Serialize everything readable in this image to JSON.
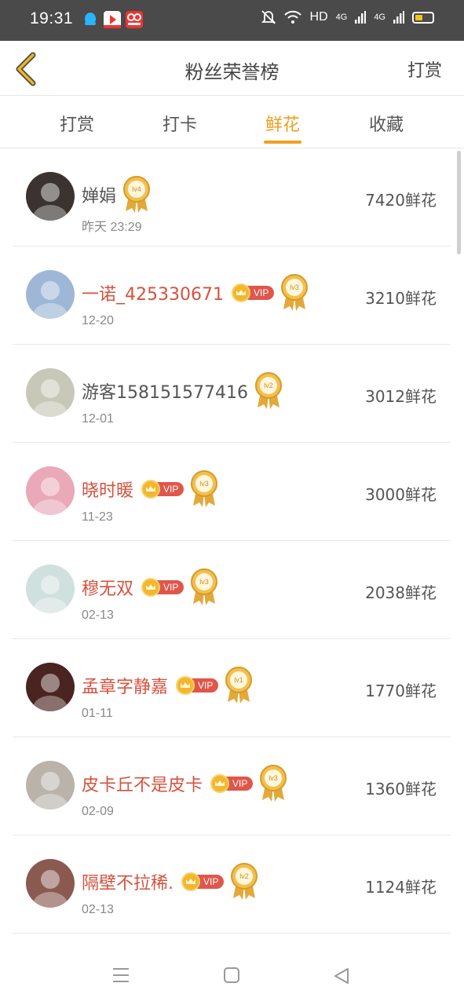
{
  "status_bar": {
    "time": "19:31",
    "network": "HD",
    "signal1": "4G",
    "signal2": "4G",
    "battery_color": "#f5c518"
  },
  "header": {
    "title": "粉丝荣誉榜",
    "right_action": "打赏",
    "back_icon": "chevron-left-icon",
    "accent": "#f0a020"
  },
  "tabs": [
    {
      "label": "打赏",
      "active": false
    },
    {
      "label": "打卡",
      "active": false
    },
    {
      "label": "鲜花",
      "active": true
    },
    {
      "label": "收藏",
      "active": false
    }
  ],
  "fans": [
    {
      "name": "婵娟",
      "vip": false,
      "level": "lv4",
      "date": "昨天 23:29",
      "amount": "7420鲜花",
      "avatar_color": "#3a3330"
    },
    {
      "name": "一诺_425330671",
      "vip": true,
      "vip_label": "VIP",
      "level": "lv3",
      "date": "12-20",
      "amount": "3210鲜花",
      "avatar_color": "#9fb7d6"
    },
    {
      "name": "游客158151577416",
      "vip": false,
      "level": "lv2",
      "date": "12-01",
      "amount": "3012鲜花",
      "avatar_color": "#c8c8b8"
    },
    {
      "name": "晓时暖",
      "vip": true,
      "vip_label": "VIP",
      "level": "lv3",
      "date": "11-23",
      "amount": "3000鲜花",
      "avatar_color": "#e9a9b8"
    },
    {
      "name": "穆无双",
      "vip": true,
      "vip_label": "VIP",
      "level": "lv3",
      "date": "02-13",
      "amount": "2038鲜花",
      "avatar_color": "#cfe0df"
    },
    {
      "name": "孟章字静嘉",
      "vip": true,
      "vip_label": "VIP",
      "level": "lv1",
      "date": "01-11",
      "amount": "1770鲜花",
      "avatar_color": "#4a2420"
    },
    {
      "name": "皮卡丘不是皮卡",
      "vip": true,
      "vip_label": "VIP",
      "level": "lv3",
      "date": "02-09",
      "amount": "1360鲜花",
      "avatar_color": "#b9b3aa"
    },
    {
      "name": "隔壁不拉稀.",
      "vip": true,
      "vip_label": "VIP",
      "level": "lv2",
      "date": "02-13",
      "amount": "1124鲜花",
      "avatar_color": "#8a5a50"
    }
  ],
  "nav": {
    "menu_icon": "menu-icon",
    "home_icon": "home-square-icon",
    "back_icon": "back-triangle-icon"
  }
}
